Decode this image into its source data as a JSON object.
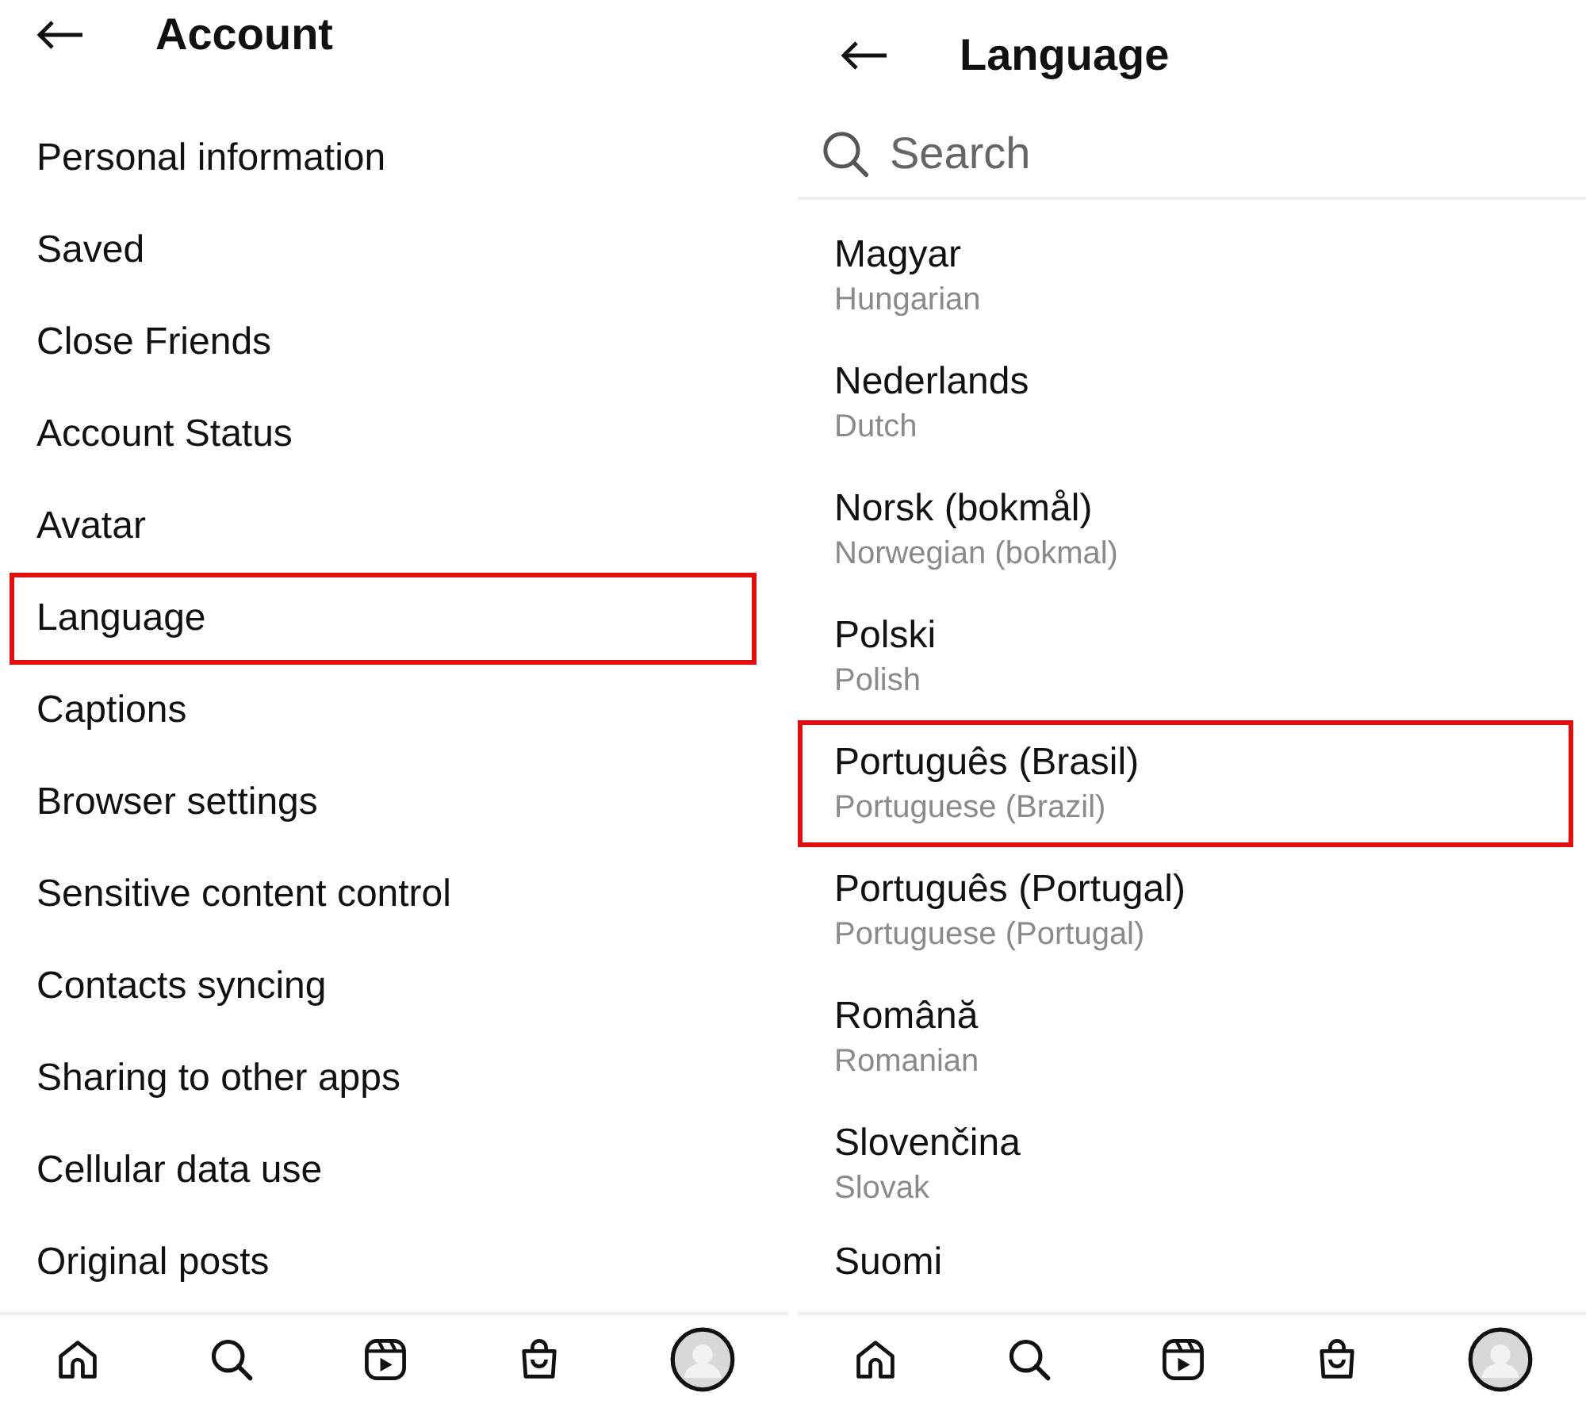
{
  "account_panel": {
    "title": "Account",
    "items": [
      {
        "label": "Personal information",
        "highlighted": false
      },
      {
        "label": "Saved",
        "highlighted": false
      },
      {
        "label": "Close Friends",
        "highlighted": false
      },
      {
        "label": "Account Status",
        "highlighted": false
      },
      {
        "label": "Avatar",
        "highlighted": false
      },
      {
        "label": "Language",
        "highlighted": true
      },
      {
        "label": "Captions",
        "highlighted": false
      },
      {
        "label": "Browser settings",
        "highlighted": false
      },
      {
        "label": "Sensitive content control",
        "highlighted": false
      },
      {
        "label": "Contacts syncing",
        "highlighted": false
      },
      {
        "label": "Sharing to other apps",
        "highlighted": false
      },
      {
        "label": "Cellular data use",
        "highlighted": false
      },
      {
        "label": "Original posts",
        "highlighted": false
      }
    ]
  },
  "language_panel": {
    "title": "Language",
    "search": {
      "placeholder": "Search"
    },
    "items": [
      {
        "name": "Magyar",
        "english": "Hungarian",
        "highlighted": false
      },
      {
        "name": "Nederlands",
        "english": "Dutch",
        "highlighted": false
      },
      {
        "name": "Norsk (bokmål)",
        "english": "Norwegian (bokmal)",
        "highlighted": false
      },
      {
        "name": "Polski",
        "english": "Polish",
        "highlighted": false
      },
      {
        "name": "Português (Brasil)",
        "english": "Portuguese (Brazil)",
        "highlighted": true
      },
      {
        "name": "Português (Portugal)",
        "english": "Portuguese (Portugal)",
        "highlighted": false
      },
      {
        "name": "Română",
        "english": "Romanian",
        "highlighted": false
      },
      {
        "name": "Slovenčina",
        "english": "Slovak",
        "highlighted": false
      },
      {
        "name": "Suomi"
      }
    ]
  }
}
